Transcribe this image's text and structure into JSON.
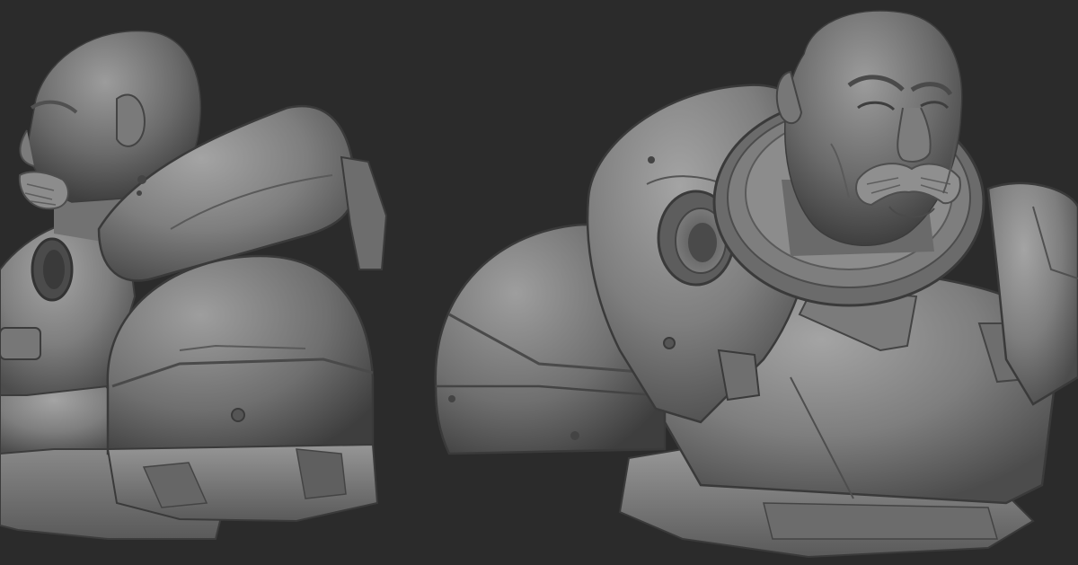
{
  "scene": {
    "background_color": "#2b2b2b",
    "material_color": "#8a8a8a",
    "shadow_color": "#4a4a4a",
    "highlight_color": "#b5b5b5",
    "views": [
      {
        "name": "side-view",
        "subject": "armored-bust"
      },
      {
        "name": "three-quarter-view",
        "subject": "armored-bust"
      }
    ]
  }
}
